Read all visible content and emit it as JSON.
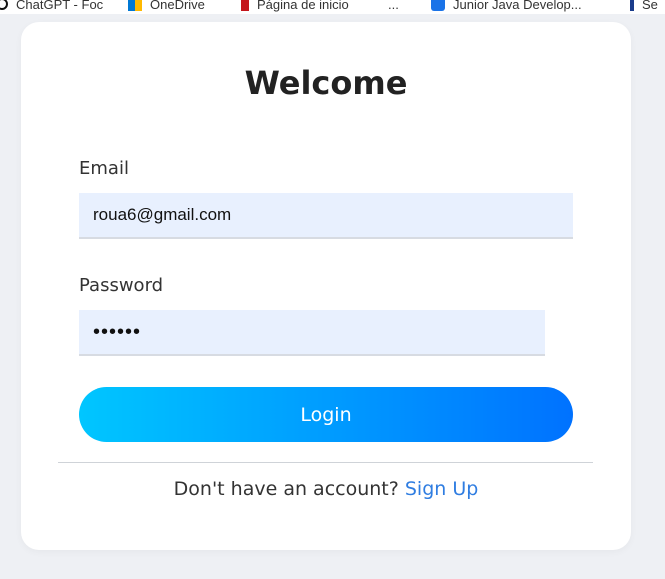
{
  "bookmarks": [
    {
      "label": "ChatGPT - Foc",
      "icon": "chatgpt-icon"
    },
    {
      "label": "OneDrive",
      "icon": "onedrive-icon"
    },
    {
      "label": "Página de inicio",
      "icon": "netflix-icon"
    },
    {
      "label": "...",
      "icon": ""
    },
    {
      "label": "Junior Java Develop...",
      "icon": "job-icon"
    },
    {
      "label": "Se",
      "icon": "f-icon"
    }
  ],
  "form": {
    "title": "Welcome",
    "email_label": "Email",
    "email_value": "roua6@gmail.com",
    "password_label": "Password",
    "password_value": "roua12",
    "login_label": "Login",
    "signup_prompt": "Don't have an account?",
    "signup_link": "Sign Up"
  },
  "colors": {
    "accent_start": "#00c6ff",
    "accent_end": "#0072ff",
    "link": "#2f7de1",
    "input_bg": "#e8f0fe"
  }
}
